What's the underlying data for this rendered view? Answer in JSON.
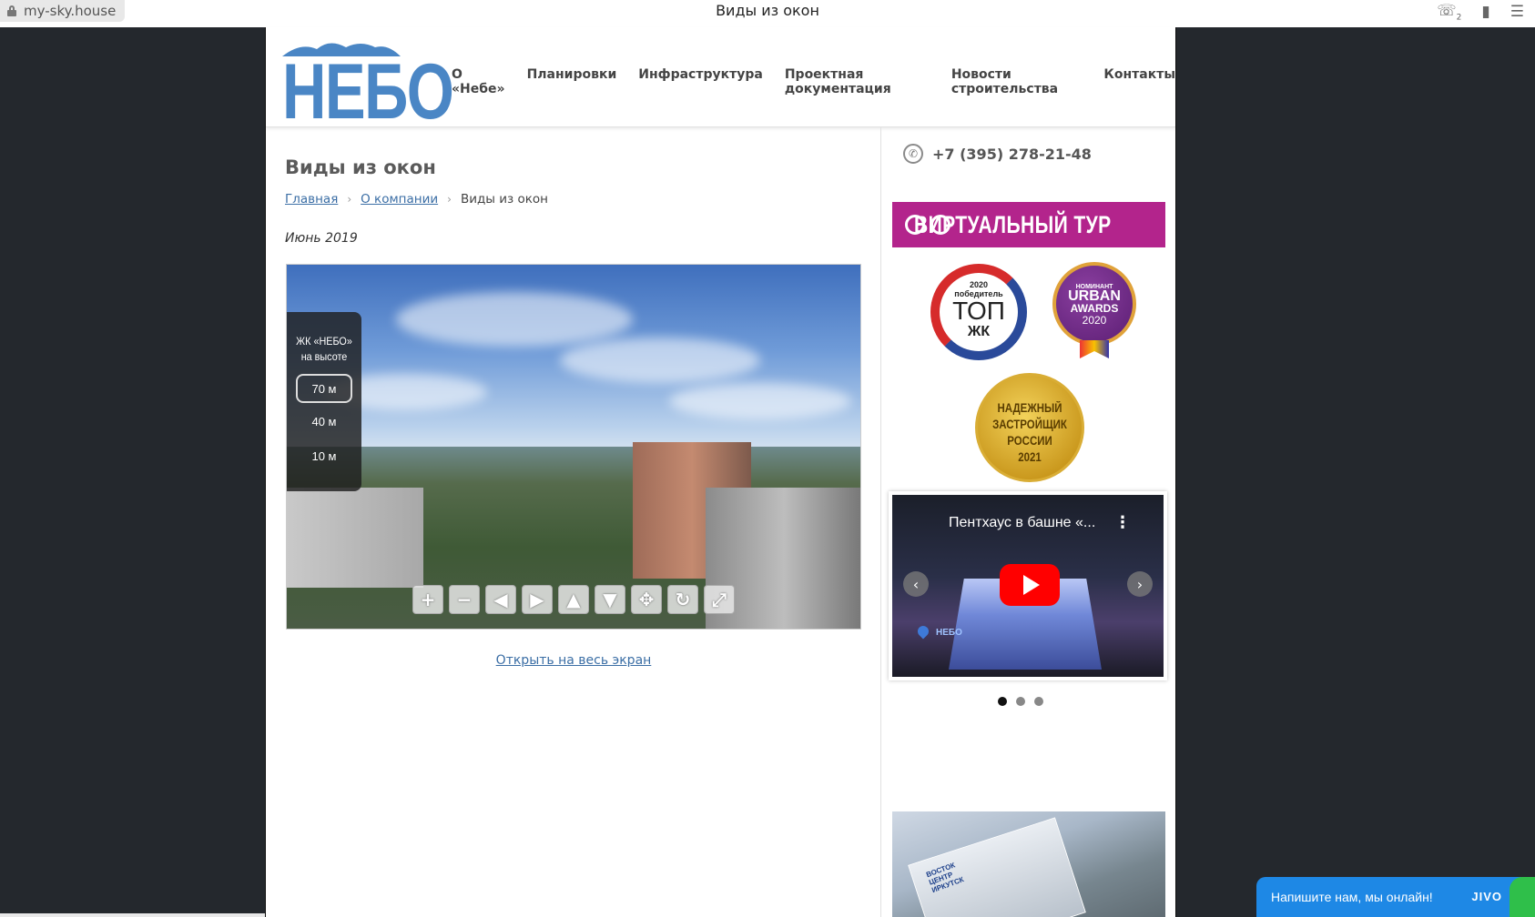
{
  "browser": {
    "url": "my-sky.house",
    "tab_title": "Виды из окон",
    "badge_count": "2"
  },
  "logo": {
    "text": "НЕБО"
  },
  "nav": {
    "items": [
      "О «Небе»",
      "Планировки",
      "Инфраструктура",
      "Проектная документация",
      "Новости строительства",
      "Контакты"
    ]
  },
  "content": {
    "title": "Виды из окон",
    "breadcrumb": {
      "home": "Главная",
      "company": "О компании",
      "current": "Виды из окон",
      "separator": "›"
    },
    "date": "Июнь 2019",
    "fullscreen_link": "Открыть на весь экран"
  },
  "panorama": {
    "panel_title_line1": "ЖК «НЕБО»",
    "panel_title_line2": "на высоте",
    "floors": [
      "70 м",
      "40 м",
      "10 м"
    ],
    "selected_floor": "70 м",
    "controls": [
      "zoom-in",
      "zoom-out",
      "left",
      "right",
      "up",
      "down",
      "move",
      "rotate",
      "fullscreen"
    ],
    "control_glyphs": [
      "+",
      "−",
      "◀",
      "▶",
      "▲",
      "▼",
      "✥",
      "↻",
      "⤢"
    ]
  },
  "sidebar": {
    "phone": "+7 (395) 278-21-48",
    "tour_banner": "ВИРТУАЛЬНЫЙ ТУР",
    "award_top": {
      "year": "2020",
      "status": "победитель",
      "title": "ТОП",
      "sub": "ЖК"
    },
    "award_urban": {
      "label": "НОМИНАНТ",
      "line1": "URBAN",
      "line2": "AWARDS",
      "year": "2020"
    },
    "award_gold": {
      "line1": "НАДЕЖНЫЙ",
      "line2": "ЗАСТРОЙЩИК",
      "line3": "РОССИИ",
      "year": "2021"
    },
    "video": {
      "title": "Пентхаус в башне «...",
      "brand": "НЕБО"
    },
    "carousel_dots": 3,
    "carousel_active": 0,
    "brochure_label": "ВОСТОК ЦЕНТР ИРКУТСК"
  },
  "chat": {
    "text": "Напишите нам, мы онлайн!",
    "brand": "JIVO"
  },
  "colors": {
    "accent_logo": "#4a86c5",
    "tour_banner": "#b3248c",
    "chat": "#1e88e5",
    "link": "#3b6ea5"
  }
}
